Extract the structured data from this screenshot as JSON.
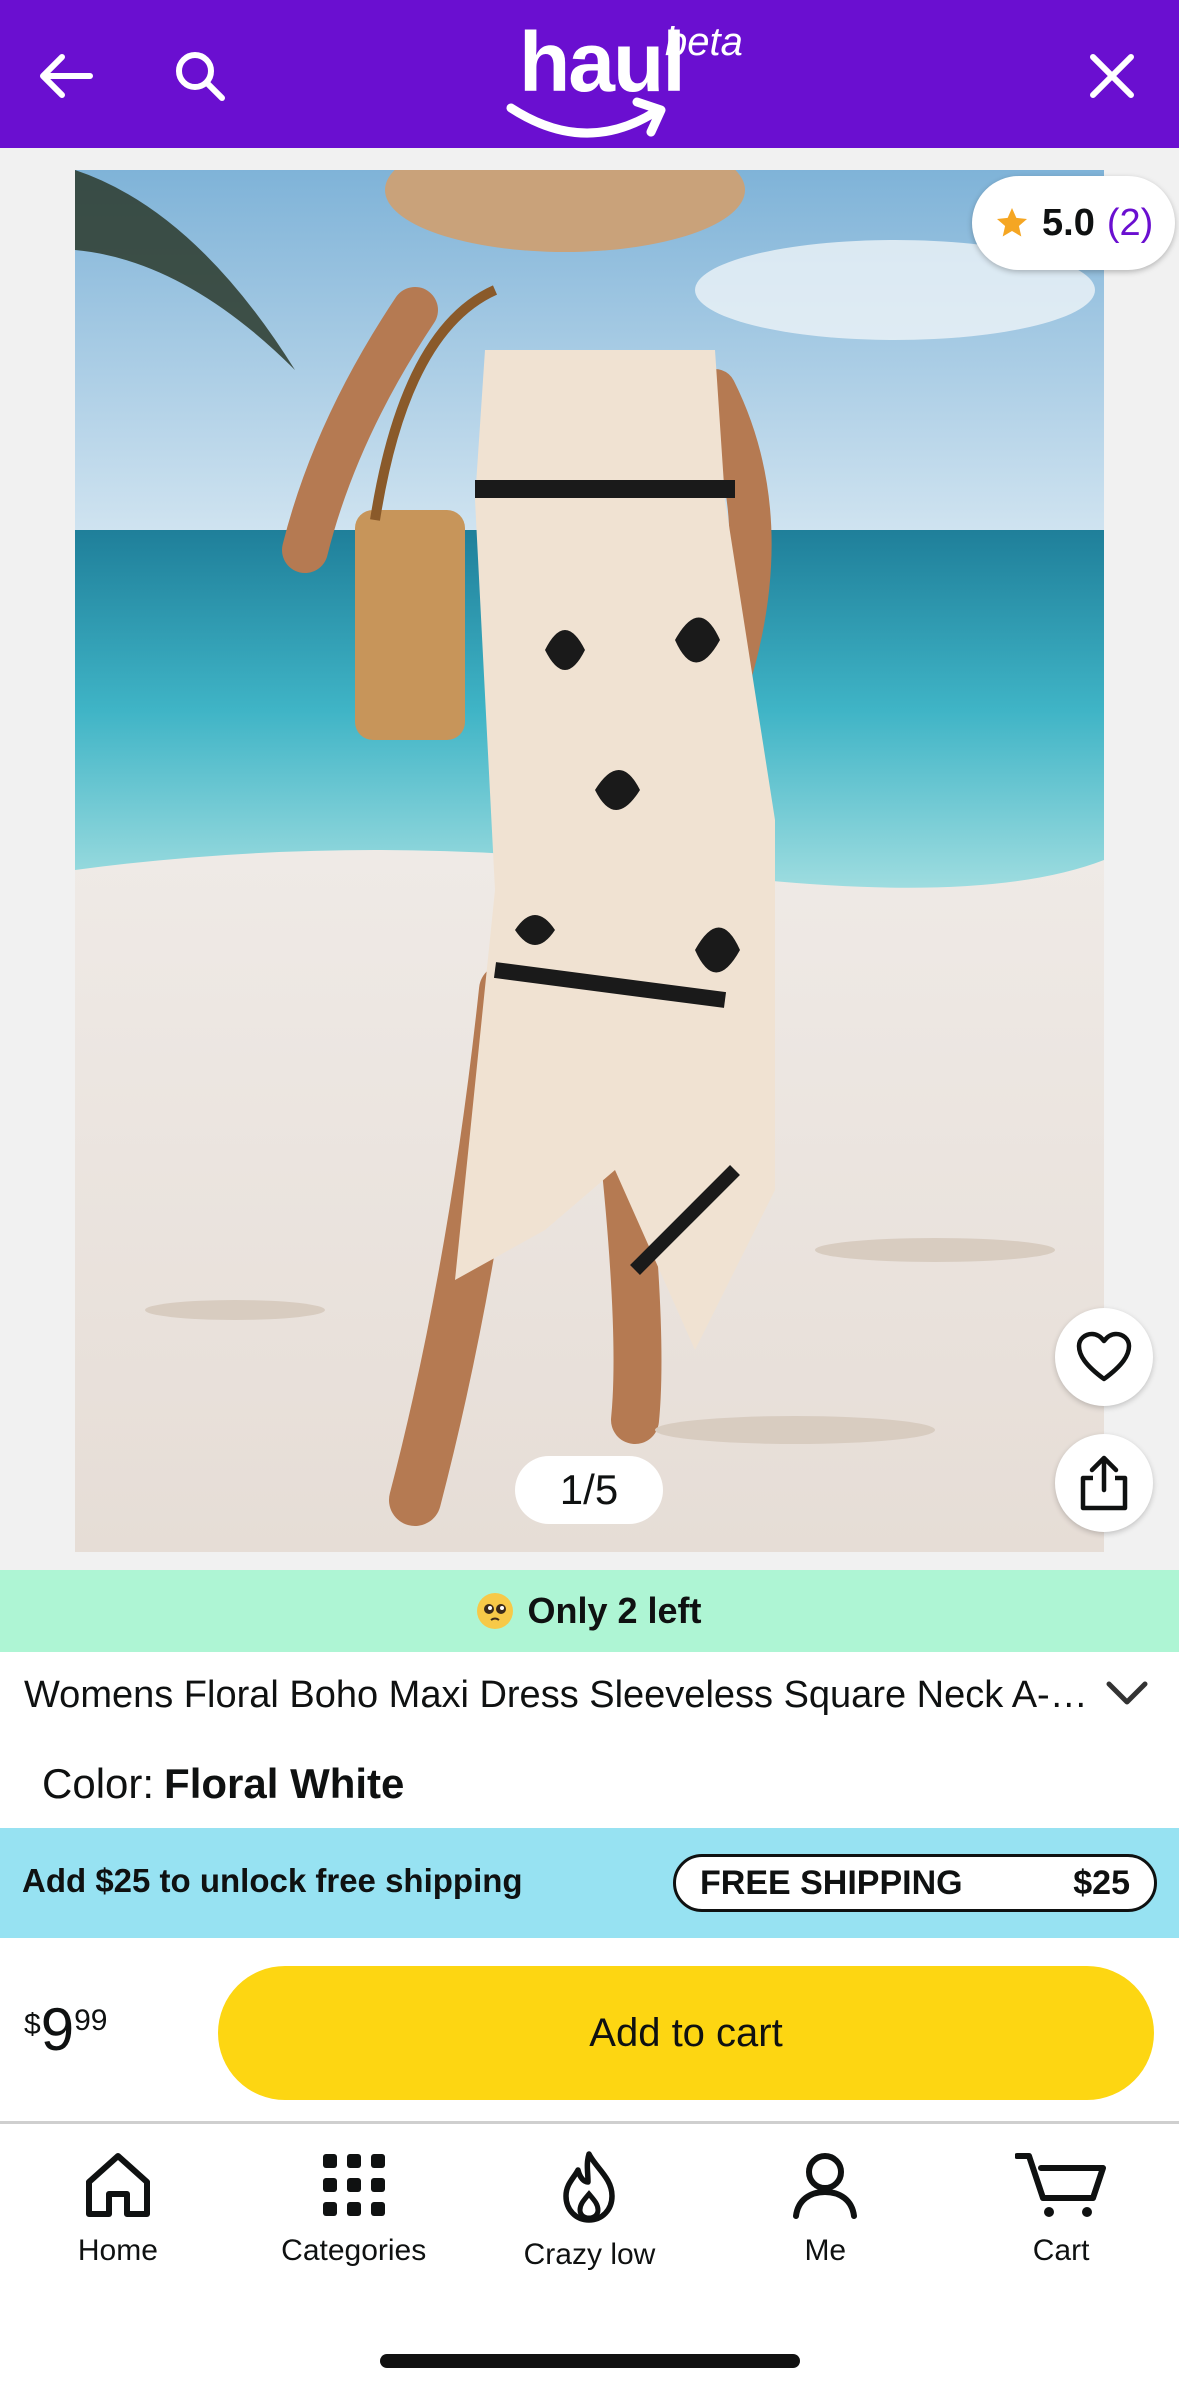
{
  "header": {
    "logo_text": "haul",
    "logo_badge": "beta",
    "back_icon": "arrow-left-icon",
    "search_icon": "search-icon",
    "close_icon": "close-icon",
    "bg_color": "#6a0fd0"
  },
  "gallery": {
    "rating_value": "5.0",
    "rating_count": "(2)",
    "counter": "1/5",
    "current_image": 1,
    "total_images": 5,
    "favorite_icon": "heart-outline-icon",
    "share_icon": "share-icon"
  },
  "stock": {
    "text": "Only 2 left",
    "emoji": "pleading-face-emoji",
    "bg_color": "#aef5d4"
  },
  "product": {
    "title": "Womens Floral Boho Maxi Dress Sleeveless Square Neck A-Line Beach Dress",
    "color_label": "Color:",
    "color_value": "Floral White"
  },
  "shipping": {
    "text": "Add $25 to unlock free shipping",
    "pill_label": "FREE SHIPPING",
    "pill_amount": "$25",
    "bg_color": "#97e2f2"
  },
  "purchase": {
    "currency_symbol": "$",
    "price_whole": "9",
    "price_fraction": "99",
    "add_to_cart_label": "Add to cart",
    "button_color": "#fdd612"
  },
  "nav": {
    "items": [
      {
        "label": "Home",
        "icon": "home-icon"
      },
      {
        "label": "Categories",
        "icon": "grid-dots-icon"
      },
      {
        "label": "Crazy low",
        "icon": "flame-icon"
      },
      {
        "label": "Me",
        "icon": "person-icon"
      },
      {
        "label": "Cart",
        "icon": "cart-icon"
      }
    ]
  }
}
